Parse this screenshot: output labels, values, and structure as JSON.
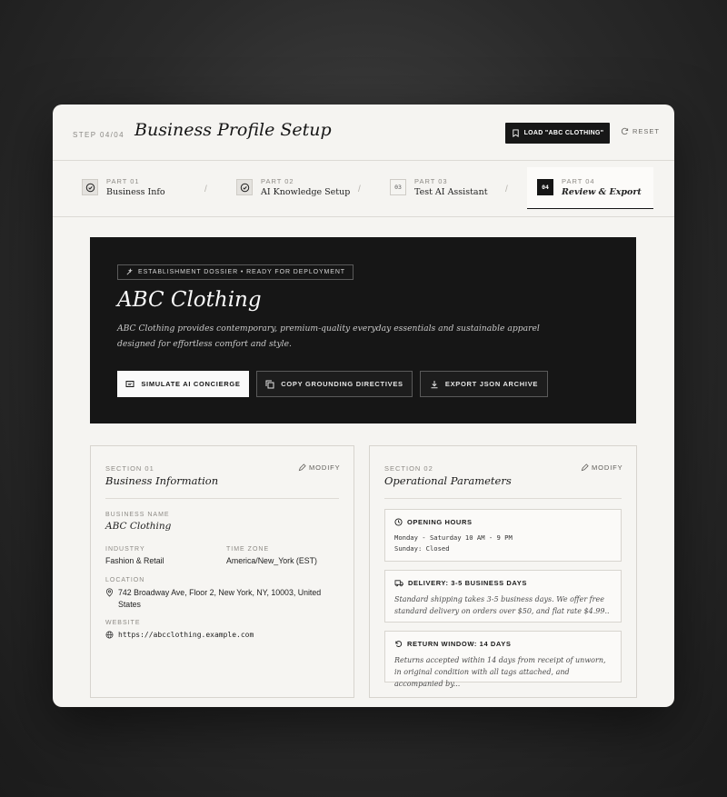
{
  "header": {
    "step": "STEP 04/04",
    "title": "Business Profile Setup",
    "load_button": "LOAD \"ABC CLOTHING\"",
    "reset": "RESET"
  },
  "stepper": [
    {
      "part": "PART 01",
      "label": "Business Info",
      "state": "done"
    },
    {
      "part": "PART 02",
      "label": "AI Knowledge Setup",
      "state": "done"
    },
    {
      "part": "PART 03",
      "number": "03",
      "label": "Test AI Assistant",
      "state": "pending"
    },
    {
      "part": "PART 04",
      "number": "04",
      "label": "Review & Export",
      "state": "active"
    }
  ],
  "hero": {
    "tag": "ESTABLISHMENT DOSSIER • READY FOR DEPLOYMENT",
    "name": "ABC Clothing",
    "description": "ABC Clothing provides contemporary, premium-quality everyday essentials and sustainable apparel designed for effortless comfort and style.",
    "buttons": {
      "simulate": "SIMULATE AI CONCIERGE",
      "copy": "COPY GROUNDING DIRECTIVES",
      "export": "EXPORT JSON ARCHIVE"
    }
  },
  "section1": {
    "number": "SECTION 01",
    "title": "Business Information",
    "modify": "MODIFY",
    "business_name_label": "BUSINESS NAME",
    "business_name": "ABC Clothing",
    "industry_label": "INDUSTRY",
    "industry": "Fashion & Retail",
    "timezone_label": "TIME ZONE",
    "timezone": "America/New_York (EST)",
    "location_label": "LOCATION",
    "location": "742 Broadway Ave, Floor 2, New York, NY, 10003, United States",
    "website_label": "WEBSITE",
    "website": "https://abcclothing.example.com"
  },
  "section2": {
    "number": "SECTION 02",
    "title": "Operational Parameters",
    "modify": "MODIFY",
    "hours_title": "OPENING HOURS",
    "hours_line1": "Monday - Saturday 10 AM - 9 PM",
    "hours_line2": "Sunday: Closed",
    "delivery_title": "DELIVERY: 3-5 BUSINESS DAYS",
    "delivery_text": "Standard shipping takes 3-5 business days. We offer free standard delivery on orders over $50, and flat rate $4.99..",
    "return_title": "RETURN WINDOW: 14 DAYS",
    "return_text": "Returns accepted within 14 days from receipt of unworn, in original condition with all tags attached, and accompanied by..."
  }
}
